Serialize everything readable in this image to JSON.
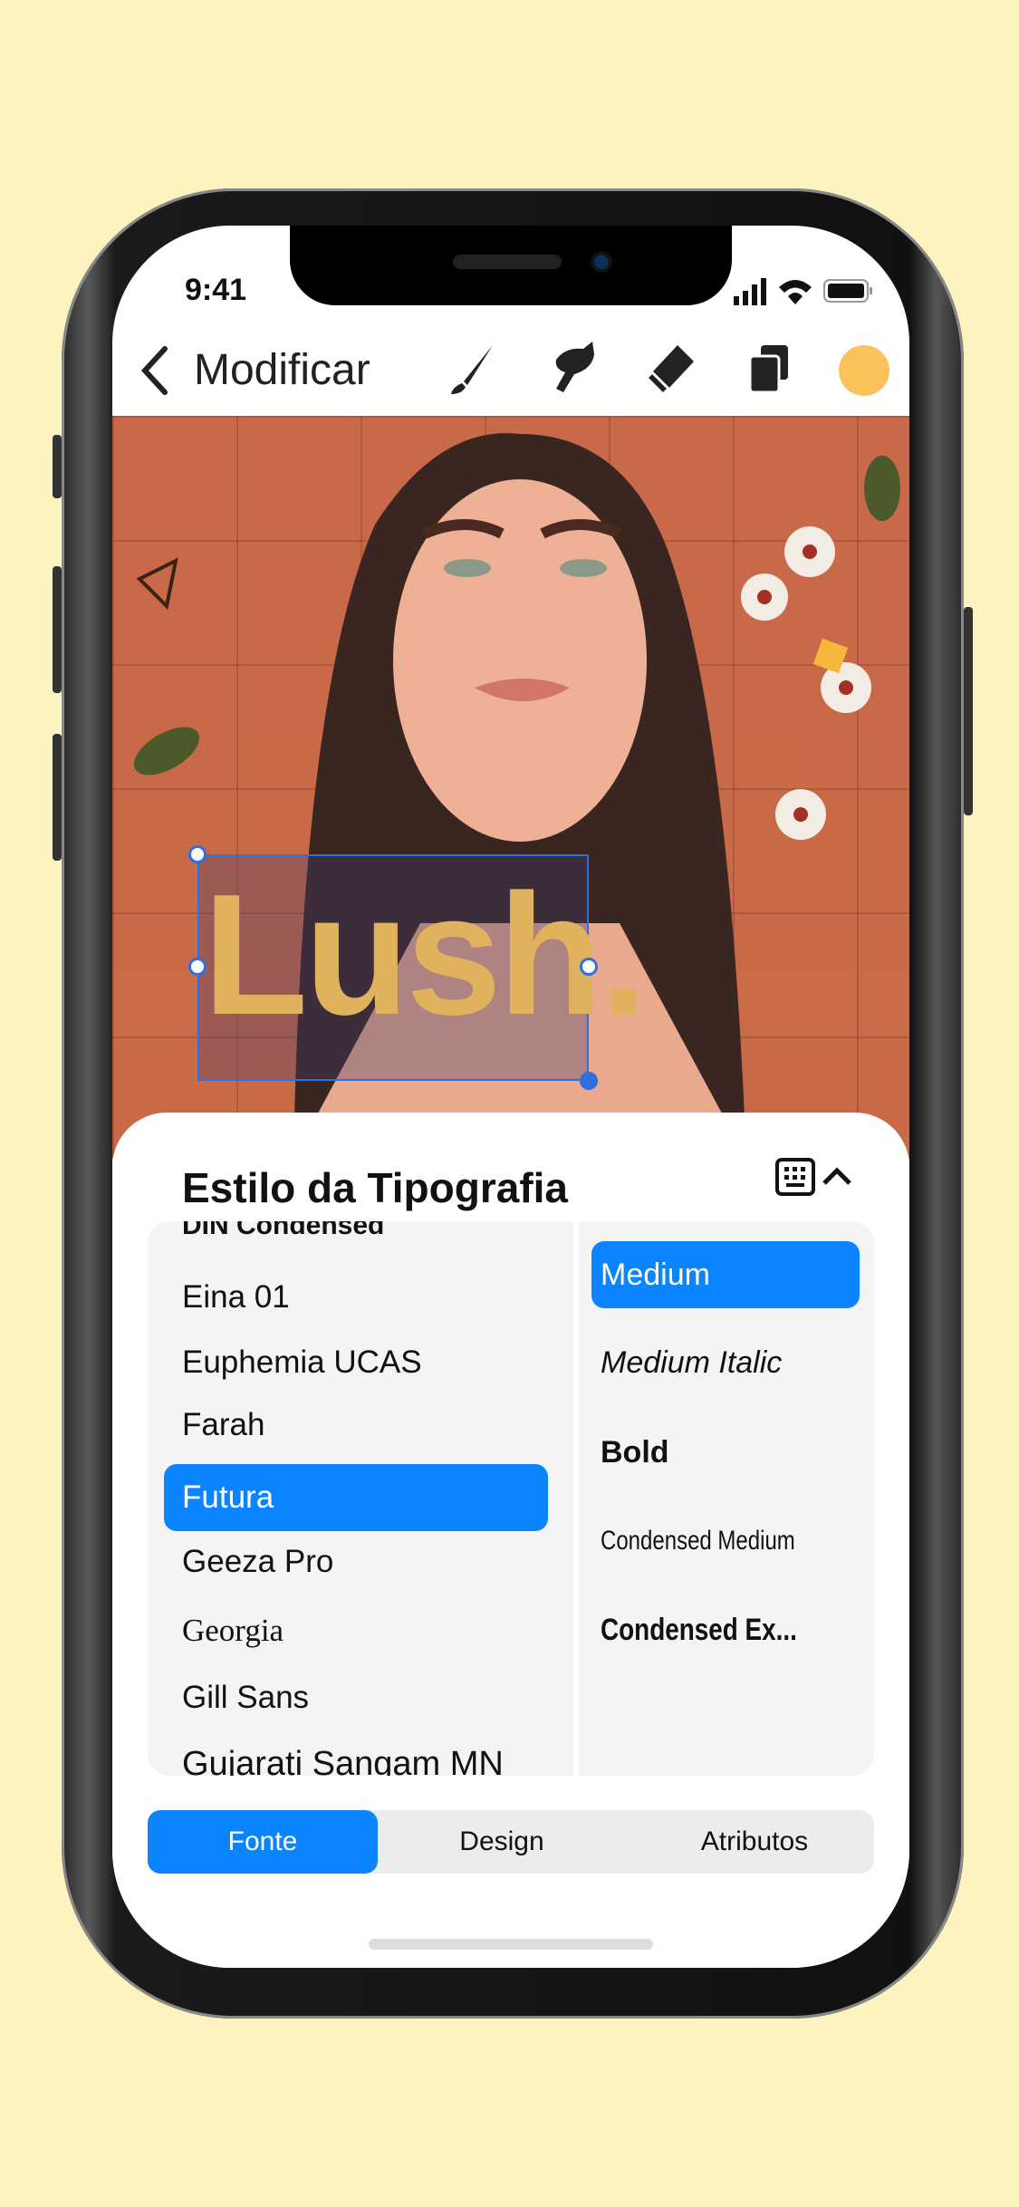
{
  "status_bar": {
    "time": "9:41"
  },
  "header": {
    "back_label": "Modificar",
    "tools": [
      "brush-icon",
      "smudge-icon",
      "eraser-icon",
      "layers-icon"
    ],
    "color_swatch": "#fbc25c"
  },
  "canvas": {
    "text_layer": "Lush."
  },
  "sheet": {
    "title": "Estilo da Tipografia",
    "fonts": [
      "DIN Condensed",
      "Eina 01",
      "Euphemia  UCAS",
      "Farah",
      "Futura",
      "Geeza Pro",
      "Georgia",
      "Gill Sans",
      "Gujarati Sangam MN"
    ],
    "selected_font": "Futura",
    "styles": [
      "Medium",
      "Medium Italic",
      "Bold",
      "Condensed Medium",
      "Condensed Ex..."
    ],
    "selected_style": "Medium",
    "tabs": [
      "Fonte",
      "Design",
      "Atributos"
    ],
    "active_tab": "Fonte"
  },
  "colors": {
    "accent": "#0a84ff",
    "background": "#fdf3c0"
  }
}
